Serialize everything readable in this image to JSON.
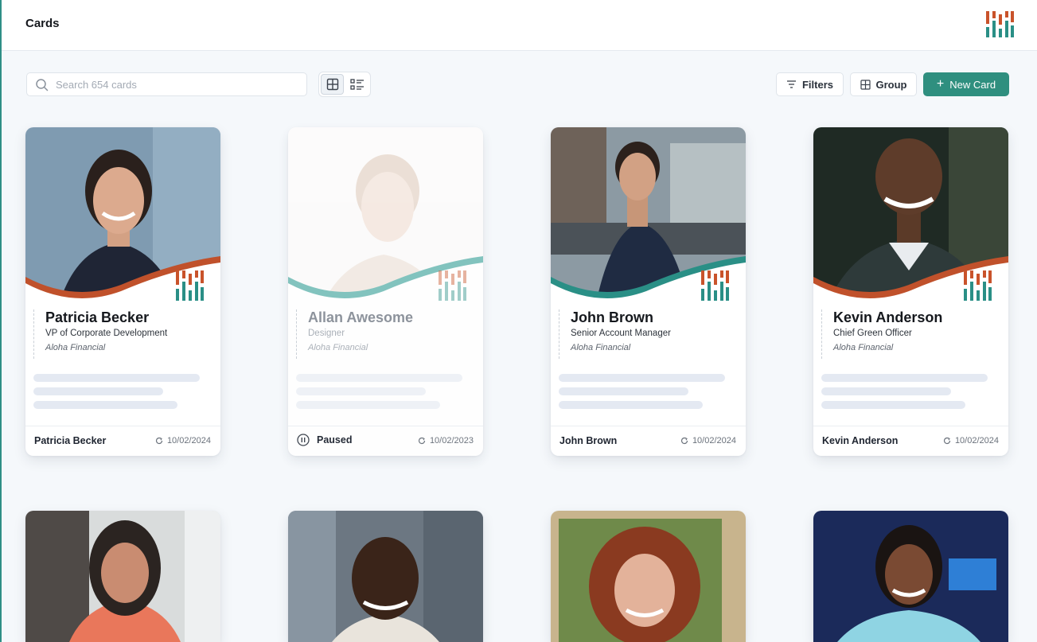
{
  "header": {
    "title": "Cards"
  },
  "toolbar": {
    "search_placeholder": "Search 654 cards",
    "filters_label": "Filters",
    "group_label": "Group",
    "new_card_label": "New Card"
  },
  "colors": {
    "accent": "#2f8f7f",
    "brand_orange": "#c9532b",
    "brand_teal": "#2a8f86"
  },
  "cards": [
    {
      "name": "Patricia Becker",
      "title": "VP of Corporate Development",
      "company": "Aloha Financial",
      "footer_name": "Patricia Becker",
      "date": "10/02/2024",
      "wave_color": "#c0512b",
      "status": "active"
    },
    {
      "name": "Allan Awesome",
      "title": "Designer",
      "company": "Aloha Financial",
      "footer_status": "Paused",
      "date": "10/02/2023",
      "wave_color": "#7fc2bd",
      "status": "paused"
    },
    {
      "name": "John Brown",
      "title": "Senior Account Manager",
      "company": "Aloha Financial",
      "footer_name": "John Brown",
      "date": "10/02/2024",
      "wave_color": "#2a8f86",
      "status": "active"
    },
    {
      "name": "Kevin Anderson",
      "title": "Chief Green Officer",
      "company": "Aloha Financial",
      "footer_name": "Kevin Anderson",
      "date": "10/02/2024",
      "wave_color": "#c0512b",
      "status": "active"
    }
  ]
}
